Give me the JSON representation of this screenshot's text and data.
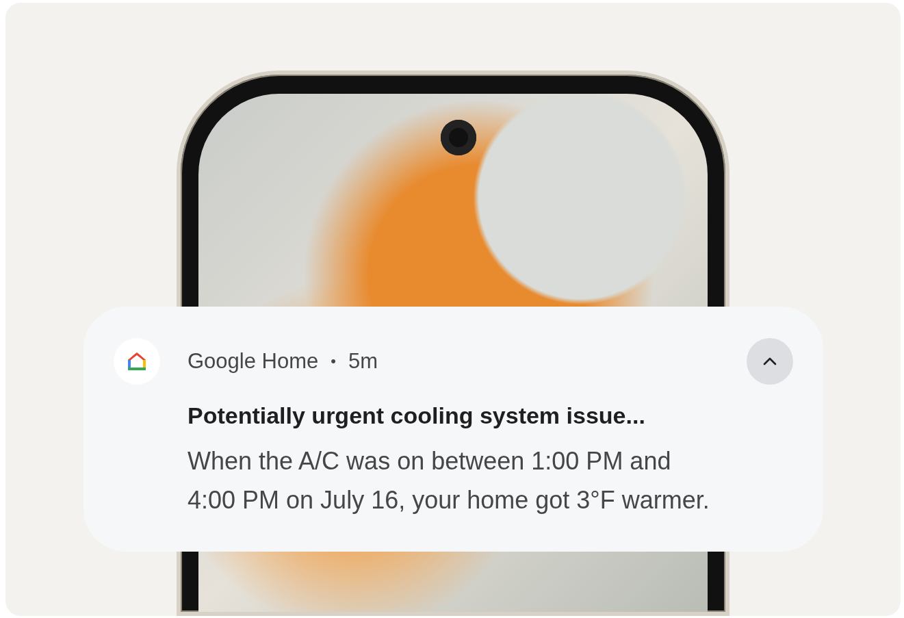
{
  "notification": {
    "app_name": "Google Home",
    "separator": "•",
    "time": "5m",
    "expanded": true,
    "title": "Potentially urgent cooling system issue...",
    "body": "When the A/C was on between 1:00 PM and 4:00 PM on July 16, your home got 3°F warmer."
  }
}
